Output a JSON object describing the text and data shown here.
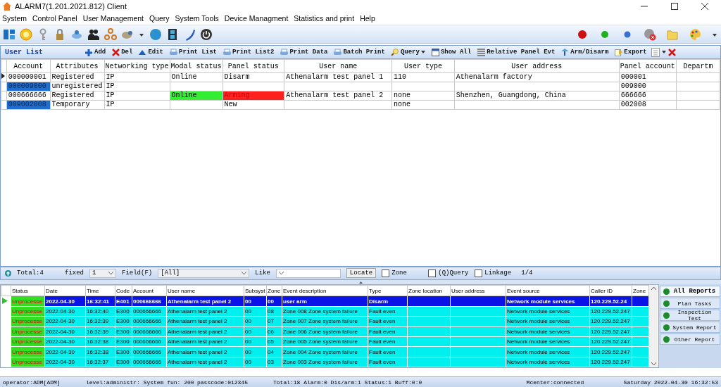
{
  "window": {
    "title": "ALARM7(1.201.2021.812) Client"
  },
  "menu": [
    "System",
    "Control Panel",
    "User Management",
    "Query",
    "System Tools",
    "Device Managment",
    "Statistics and print",
    "Help"
  ],
  "user_list": {
    "title": "User List",
    "actions": [
      {
        "kind": "add",
        "label": "Add"
      },
      {
        "kind": "delete",
        "label": "Del"
      },
      {
        "kind": "edit",
        "label": "Edit"
      },
      {
        "kind": "print",
        "label": "Print List"
      },
      {
        "kind": "print",
        "label": "Print List2"
      },
      {
        "kind": "print",
        "label": "Print Data"
      },
      {
        "kind": "print",
        "label": "Batch Print"
      },
      {
        "kind": "query",
        "label": "Query"
      },
      {
        "kind": "calendar",
        "label": "Show All"
      },
      {
        "kind": "list",
        "label": "Relative Panel Evt"
      },
      {
        "kind": "arm",
        "label": "Arm/Disarm"
      },
      {
        "kind": "export",
        "label": "Export"
      }
    ],
    "columns": [
      "Account",
      "Attributes",
      "Networking type",
      "Modal status",
      "Panel status",
      "User name",
      "User type",
      "User address",
      "Panel account",
      "Departm"
    ],
    "rows": [
      {
        "current": true,
        "account_highlight": false,
        "cells": [
          "000000001",
          "Registered",
          "IP",
          "Online",
          "Disarm",
          "Athenalarm test panel 1",
          "110",
          "Athenalarm factory",
          "000001",
          null
        ]
      },
      {
        "current": false,
        "account_highlight": true,
        "cells": [
          "000009000",
          "unregistered",
          "IP",
          null,
          null,
          null,
          null,
          null,
          "009000",
          null
        ]
      },
      {
        "current": false,
        "account_highlight": false,
        "cells": [
          "000666666",
          "Registered",
          "IP",
          {
            "text": "Online",
            "color": "#33ee33"
          },
          {
            "text": "Arming",
            "color": "#ff2020"
          },
          "Athenalarm test panel 2",
          "none",
          "Shenzhen, Guangdong, China",
          "666666",
          null
        ]
      },
      {
        "current": false,
        "account_highlight": true,
        "cells": [
          "009002008",
          "Temporary",
          "IP",
          null,
          "New",
          null,
          "none",
          null,
          "002008",
          null
        ]
      }
    ]
  },
  "filter": {
    "total": "Total:4",
    "fixed_label": "fixed",
    "fixed_value": "1",
    "field_label": "Field(F)",
    "field_value": "[All]",
    "like_label": "Like",
    "locate": "Locate",
    "checks": [
      {
        "label": "Zone",
        "checked": false
      },
      {
        "label": "(Q)Query",
        "checked": false
      },
      {
        "label": "Linkage",
        "checked": false
      }
    ],
    "page": "1/4"
  },
  "events": {
    "columns": [
      "Status",
      "Date",
      "Time",
      "Code",
      "Account",
      "User name",
      "Subsyst",
      "Zone",
      "Event description",
      "Type",
      "Zone location",
      "User address",
      "Event source",
      "Caller ID",
      "Zone"
    ],
    "rows": [
      {
        "selected": true,
        "cells": [
          "Unprocesse",
          "2022-04-30",
          "16:32:41",
          "E401",
          "000666666",
          "Athenalarm test panel 2",
          "00",
          "00",
          "user arm",
          "Disarm",
          null,
          null,
          "Network module services",
          "120.229.52.24",
          null
        ]
      },
      {
        "selected": false,
        "cells": [
          "Unprocesse",
          "2022-04-30",
          "16:32:40",
          "E300",
          "000666666",
          "Athenalarm test panel 2",
          "00",
          "08",
          "Zone 008 Zone system failure",
          "Fault even",
          null,
          null,
          "Network module services",
          "120.229.52.247",
          null
        ]
      },
      {
        "selected": false,
        "cells": [
          "Unprocesse",
          "2022-04-30",
          "16:32:39",
          "E300",
          "000666666",
          "Athenalarm test panel 2",
          "00",
          "07",
          "Zone 007 Zone system failure",
          "Fault even",
          null,
          null,
          "Network module services",
          "120.229.52.247",
          null
        ]
      },
      {
        "selected": false,
        "cells": [
          "Unprocesse",
          "2022-04-30",
          "16:32:39",
          "E300",
          "000666666",
          "Athenalarm test panel 2",
          "00",
          "06",
          "Zone 006 Zone system failure",
          "Fault even",
          null,
          null,
          "Network module services",
          "120.229.52.247",
          null
        ]
      },
      {
        "selected": false,
        "cells": [
          "Unprocesse",
          "2022-04-30",
          "16:32:38",
          "E300",
          "000666666",
          "Athenalarm test panel 2",
          "00",
          "05",
          "Zone 005 Zone system failure",
          "Fault even",
          null,
          null,
          "Network module services",
          "120.229.52.247",
          null
        ]
      },
      {
        "selected": false,
        "cells": [
          "Unprocesse",
          "2022-04-30",
          "16:32:38",
          "E300",
          "000666666",
          "Athenalarm test panel 2",
          "00",
          "04",
          "Zone 004 Zone system failure",
          "Fault even",
          null,
          null,
          "Network module services",
          "120.229.52.247",
          null
        ]
      },
      {
        "selected": false,
        "cells": [
          "Unprocesse",
          "2022-04-30",
          "16:32:37",
          "E300",
          "000666666",
          "Athenalarm test panel 2",
          "00",
          "03",
          "Zone 003 Zone system failure",
          "Fault even",
          null,
          null,
          "Network module services",
          "120.229.52.247",
          null
        ]
      }
    ]
  },
  "reports": [
    {
      "label": "All Reports",
      "selected": true
    },
    {
      "label": "Plan Tasks",
      "selected": false
    },
    {
      "label": "Inspection Test",
      "selected": false
    },
    {
      "label": "System Report",
      "selected": false
    },
    {
      "label": "Other Report",
      "selected": false
    }
  ],
  "status_bar": [
    "operator:ADM[ADM]",
    "level:administr: System fun: 200",
    "passcode:012345",
    "Total:18 Alarm:0 Dis/arm:1 Status:1 Buff:0:0",
    "Mcenter:connected",
    "Saturday 2022-04-30 16:32:53"
  ]
}
